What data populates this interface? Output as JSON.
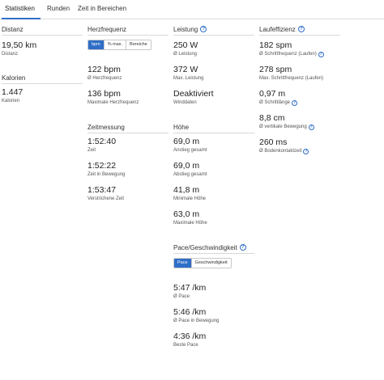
{
  "tabs": [
    {
      "label": "Statistiken",
      "active": true
    },
    {
      "label": "Runden"
    },
    {
      "label": "Zeit in Bereichen"
    }
  ],
  "col1": {
    "distance_head": "Distanz",
    "distance_value": "19,50 km",
    "distance_label": "Distanz",
    "calories_head": "Kalorien",
    "calories_value": "1.447",
    "calories_label": "Kalorien"
  },
  "col2": {
    "hr_head": "Herzfrequenz",
    "hr_toggle": [
      "bpm",
      "% max.",
      "Bereiche"
    ],
    "hr_avg_value": "122 bpm",
    "hr_avg_label": "Ø Herzfrequenz",
    "hr_max_value": "136 bpm",
    "hr_max_label": "Maximale Herzfrequenz",
    "time_head": "Zeitmessung",
    "time_value": "1:52:40",
    "time_label": "Zeit",
    "moving_value": "1:52:22",
    "moving_label": "Zeit in Bewegung",
    "elapsed_value": "1:53:47",
    "elapsed_label": "Verstrichene Zeit"
  },
  "col3": {
    "power_head": "Leistung",
    "power_avg_value": "250 W",
    "power_avg_label": "Ø Leistung",
    "power_max_value": "372 W",
    "power_max_label": "Max. Leistung",
    "wind_value": "Deaktiviert",
    "wind_label": "Winddaten",
    "elev_head": "Höhe",
    "ascent_value": "69,0 m",
    "ascent_label": "Anstieg gesamt",
    "descent_value": "69,0 m",
    "descent_label": "Abstieg gesamt",
    "min_value": "41,8 m",
    "min_label": "Minimale Höhe",
    "max_value": "63,0 m",
    "max_label": "Maximale Höhe",
    "pace_head": "Pace/Geschwindigkeit",
    "pace_toggle": [
      "Pace",
      "Geschwindigkeit"
    ],
    "pace_avg_value": "5:47 /km",
    "pace_avg_label": "Ø Pace",
    "pace_moving_value": "5:46 /km",
    "pace_moving_label": "Ø Pace in Bewegung",
    "pace_best_value": "4:36 /km",
    "pace_best_label": "Beste Pace"
  },
  "col4": {
    "eff_head": "Laufeffizienz",
    "cad_avg_value": "182 spm",
    "cad_avg_label": "Ø Schrittfrequenz (Laufen)",
    "cad_max_value": "278 spm",
    "cad_max_label": "Max. Schrittfrequenz (Laufen)",
    "stride_value": "0,97 m",
    "stride_label": "Ø Schrittlänge",
    "vosc_value": "8,8 cm",
    "vosc_label": "Ø vertikale Bewegung",
    "gct_value": "260 ms",
    "gct_label": "Ø Bodenkontaktzeit"
  },
  "icons": {
    "info": "info-icon",
    "accent": "#2f6ec7"
  }
}
